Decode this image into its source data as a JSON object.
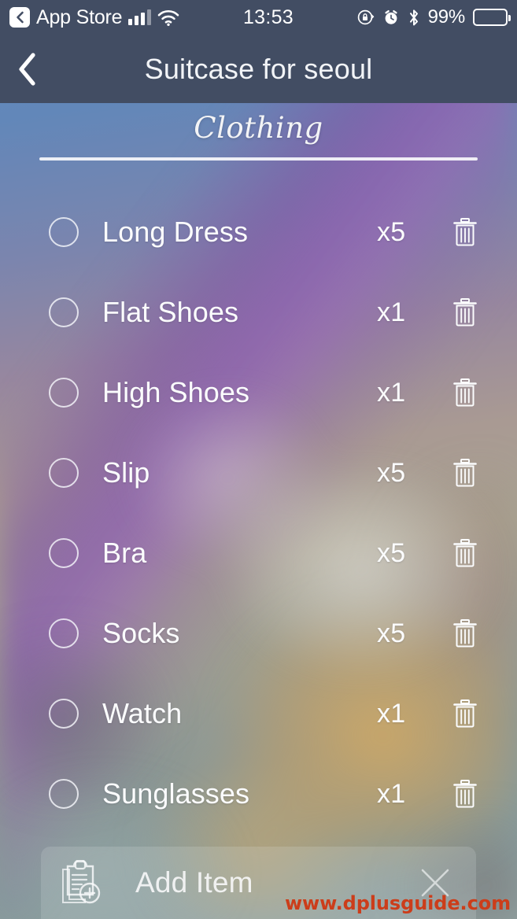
{
  "status_bar": {
    "back_icon": "chevron-left-icon",
    "carrier_label": "App Store",
    "signal_icon": "cellular-signal-icon",
    "wifi_icon": "wifi-icon",
    "time": "13:53",
    "rotation_lock_icon": "rotation-lock-icon",
    "alarm_icon": "alarm-clock-icon",
    "bluetooth_icon": "bluetooth-icon",
    "battery_percent": "99%",
    "battery_icon": "battery-full-icon"
  },
  "nav_bar": {
    "back_icon": "chevron-left-icon",
    "title": "Suitcase for seoul"
  },
  "section": {
    "title": "Clothing"
  },
  "items": [
    {
      "name": "Long Dress",
      "qty": "x5",
      "checkbox_icon": "circle-unchecked-icon",
      "delete_icon": "trash-icon",
      "checked": false
    },
    {
      "name": "Flat Shoes",
      "qty": "x1",
      "checkbox_icon": "circle-unchecked-icon",
      "delete_icon": "trash-icon",
      "checked": false
    },
    {
      "name": "High Shoes",
      "qty": "x1",
      "checkbox_icon": "circle-unchecked-icon",
      "delete_icon": "trash-icon",
      "checked": false
    },
    {
      "name": "Slip",
      "qty": "x5",
      "checkbox_icon": "circle-unchecked-icon",
      "delete_icon": "trash-icon",
      "checked": false
    },
    {
      "name": "Bra",
      "qty": "x5",
      "checkbox_icon": "circle-unchecked-icon",
      "delete_icon": "trash-icon",
      "checked": false
    },
    {
      "name": "Socks",
      "qty": "x5",
      "checkbox_icon": "circle-unchecked-icon",
      "delete_icon": "trash-icon",
      "checked": false
    },
    {
      "name": "Watch",
      "qty": "x1",
      "checkbox_icon": "circle-unchecked-icon",
      "delete_icon": "trash-icon",
      "checked": false
    },
    {
      "name": "Sunglasses",
      "qty": "x1",
      "checkbox_icon": "circle-unchecked-icon",
      "delete_icon": "trash-icon",
      "checked": false
    }
  ],
  "add_bar": {
    "icon": "clipboard-add-icon",
    "label": "Add Item",
    "close_icon": "close-x-icon"
  },
  "watermark": {
    "text": "www.dplusguide.com"
  },
  "colors": {
    "chrome_bar": "#424d63",
    "text_primary": "#fbfcfd",
    "watermark": "#cc3d1a",
    "bg_sky": "#5e8bbe",
    "bg_purple": "#8c60af",
    "bg_gold": "#d6aa60"
  }
}
